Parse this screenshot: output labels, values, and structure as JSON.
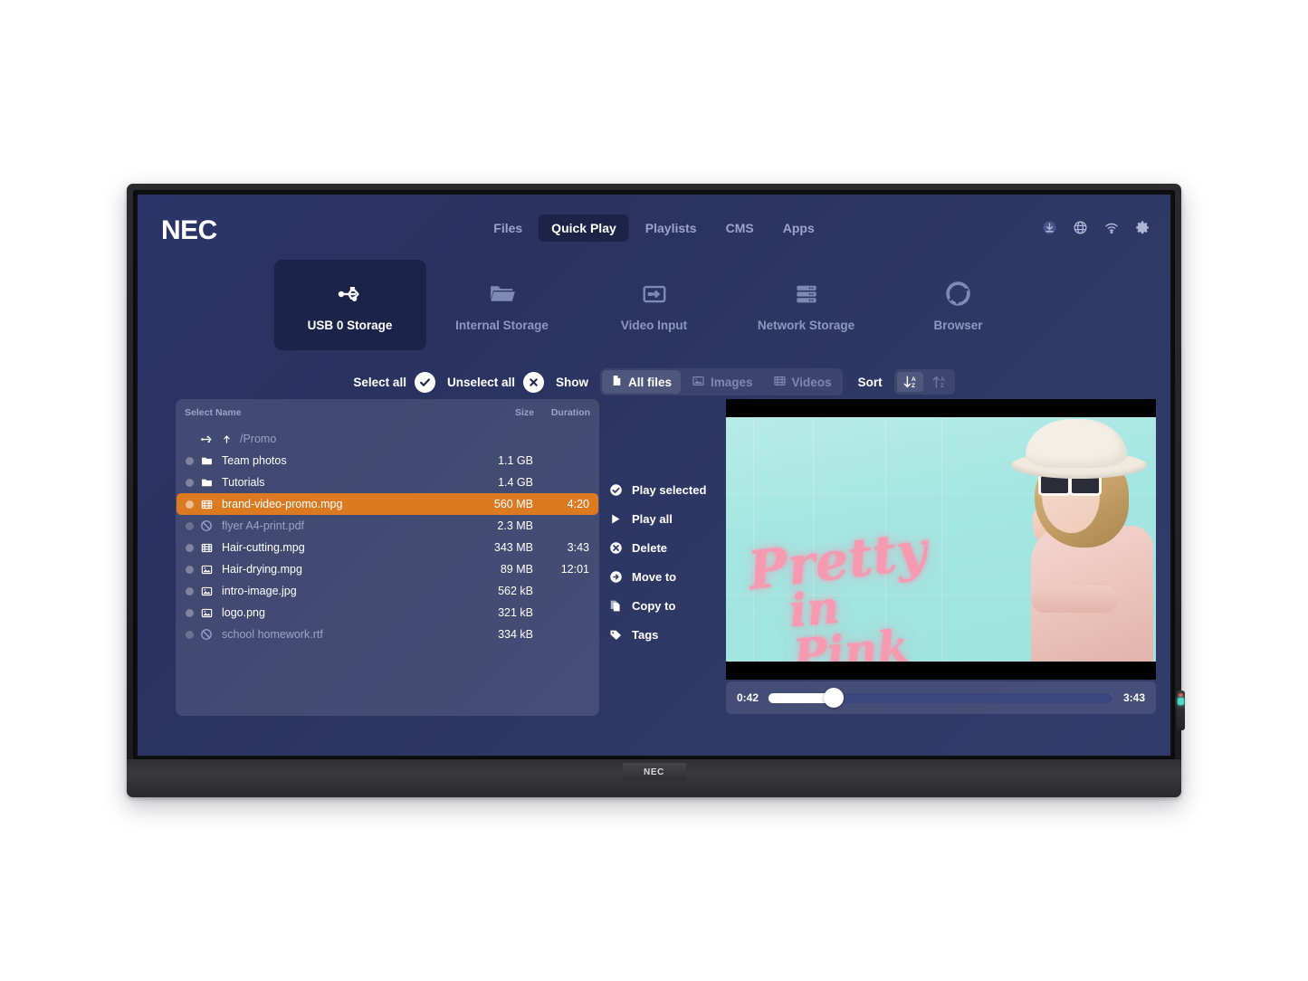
{
  "brand": {
    "logo": "NEC",
    "chin_logo": "NEC"
  },
  "nav": {
    "items": [
      {
        "label": "Files",
        "active": false
      },
      {
        "label": "Quick Play",
        "active": true
      },
      {
        "label": "Playlists",
        "active": false
      },
      {
        "label": "CMS",
        "active": false
      },
      {
        "label": "Apps",
        "active": false
      }
    ]
  },
  "system_icons": [
    {
      "name": "download-icon"
    },
    {
      "name": "globe-icon"
    },
    {
      "name": "wifi-icon"
    },
    {
      "name": "gear-icon"
    }
  ],
  "sources": [
    {
      "label": "USB 0 Storage",
      "icon": "usb-icon",
      "active": true
    },
    {
      "label": "Internal Storage",
      "icon": "folder-icon",
      "active": false
    },
    {
      "label": "Video Input",
      "icon": "video-input-icon",
      "active": false
    },
    {
      "label": "Network Storage",
      "icon": "server-rack-icon",
      "active": false
    },
    {
      "label": "Browser",
      "icon": "chrome-browser-icon",
      "active": false
    }
  ],
  "toolbar": {
    "select_all_label": "Select all",
    "unselect_all_label": "Unselect all",
    "show_label": "Show",
    "filters": [
      {
        "label": "All files",
        "icon": "file-icon",
        "active": true
      },
      {
        "label": "Images",
        "icon": "image-icon",
        "active": false
      },
      {
        "label": "Videos",
        "icon": "film-icon",
        "active": false
      }
    ],
    "sort_label": "Sort",
    "sort_buttons": [
      {
        "name": "sort-descending",
        "glyph": "↓",
        "az": "A\nZ",
        "active": true
      },
      {
        "name": "sort-ascending",
        "glyph": "↑",
        "az": "A\nZ",
        "active": false
      }
    ]
  },
  "filelist": {
    "columns": {
      "select": "Select",
      "name": "Name",
      "size": "Size",
      "duration": "Duration"
    },
    "breadcrumb": {
      "icon": "usb-icon",
      "up_icon": "level-up-icon",
      "path": "/Promo"
    },
    "rows": [
      {
        "name": "Team photos",
        "size": "1.1 GB",
        "duration": "",
        "icon": "folder-icon",
        "state": "normal"
      },
      {
        "name": "Tutorials",
        "size": "1.4 GB",
        "duration": "",
        "icon": "folder-icon",
        "state": "normal"
      },
      {
        "name": "brand-video-promo.mpg",
        "size": "560 MB",
        "duration": "4:20",
        "icon": "film-icon",
        "state": "selected"
      },
      {
        "name": "flyer A4-print.pdf",
        "size": "2.3 MB",
        "duration": "",
        "icon": "blocked-icon",
        "state": "disabled"
      },
      {
        "name": "Hair-cutting.mpg",
        "size": "343 MB",
        "duration": "3:43",
        "icon": "film-icon",
        "state": "normal"
      },
      {
        "name": "Hair-drying.mpg",
        "size": "89 MB",
        "duration": "12:01",
        "icon": "image-icon",
        "state": "normal"
      },
      {
        "name": "intro-image.jpg",
        "size": "562 kB",
        "duration": "",
        "icon": "image-icon",
        "state": "normal"
      },
      {
        "name": "logo.png",
        "size": "321 kB",
        "duration": "",
        "icon": "image-icon",
        "state": "normal"
      },
      {
        "name": "school homework.rtf",
        "size": "334 kB",
        "duration": "",
        "icon": "blocked-icon",
        "state": "disabled"
      }
    ]
  },
  "actions": [
    {
      "label": "Play selected",
      "icon": "check-circle-icon"
    },
    {
      "label": "Play all",
      "icon": "play-triangle-icon"
    },
    {
      "label": "Delete",
      "icon": "x-circle-icon"
    },
    {
      "label": "Move to",
      "icon": "arrow-circle-icon"
    },
    {
      "label": "Copy to",
      "icon": "copy-icon"
    },
    {
      "label": "Tags",
      "icon": "tag-icon"
    }
  ],
  "player": {
    "current_time": "0:42",
    "total_time": "3:43",
    "progress_percent": 19,
    "poster": {
      "headline_line1": "Pretty",
      "headline_line2": "in Pink"
    }
  },
  "colors": {
    "screen_bg": "#2e3865",
    "accent_orange": "#dc7a22",
    "nav_active_bg": "#1d2346",
    "panel_bg": "rgba(255,255,255,0.115)",
    "muted_text": "#8d98bf",
    "poster_bg": "#a9e7e3",
    "neon_pink": "#f59ab0"
  }
}
